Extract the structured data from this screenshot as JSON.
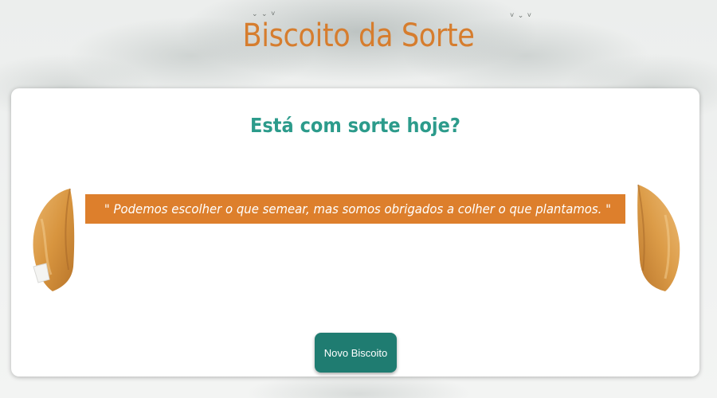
{
  "header": {
    "title": "Biscoito da Sorte"
  },
  "card": {
    "heading": "Está com sorte hoje?",
    "fortune": "\" Podemos escolher o que semear, mas somos obrigados a colher o que plantamos. \"",
    "button_label": "Novo Biscoito"
  },
  "images": {
    "left_cookie": "fortune-cookie-image",
    "right_cookie": "fortune-cookie-half-image",
    "background": "misty-mountains-background"
  },
  "colors": {
    "title": "#d67d2e",
    "heading": "#2c9b8b",
    "fortune_bar": "#dd7f2c",
    "button": "#1f7c71",
    "card": "#ffffff"
  }
}
